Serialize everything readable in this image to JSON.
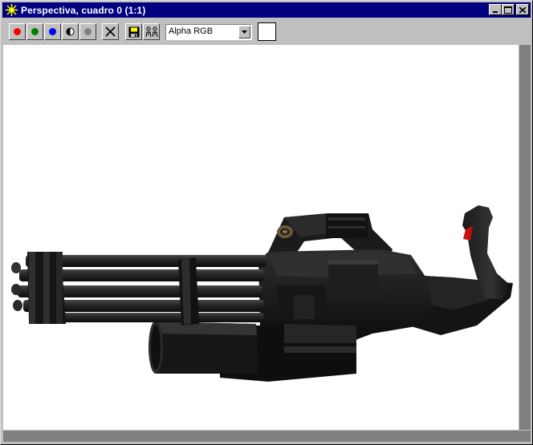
{
  "window": {
    "title": "Perspectiva, cuadro 0 (1:1)",
    "icon": "sun-icon"
  },
  "caption_buttons": [
    "minimize-icon",
    "maximize-icon",
    "close-icon"
  ],
  "toolbar": {
    "channel_buttons": [
      {
        "name": "red-channel",
        "color": "#ff0000"
      },
      {
        "name": "green-channel",
        "color": "#008000"
      },
      {
        "name": "blue-channel",
        "color": "#0000ff"
      },
      {
        "name": "alpha-channel",
        "icon": "half-circle-icon"
      },
      {
        "name": "monochrome-channel",
        "color": "#808080"
      }
    ],
    "clear_icon": "x-icon",
    "save_icon": "floppy-icon",
    "clone_icon": "clone-people-icon",
    "channel_select": {
      "value": "Alpha RGB"
    },
    "swatch_color": "#ffffff"
  },
  "viewport": {
    "background": "#ffffff",
    "content": "rendered-minigun-model"
  }
}
